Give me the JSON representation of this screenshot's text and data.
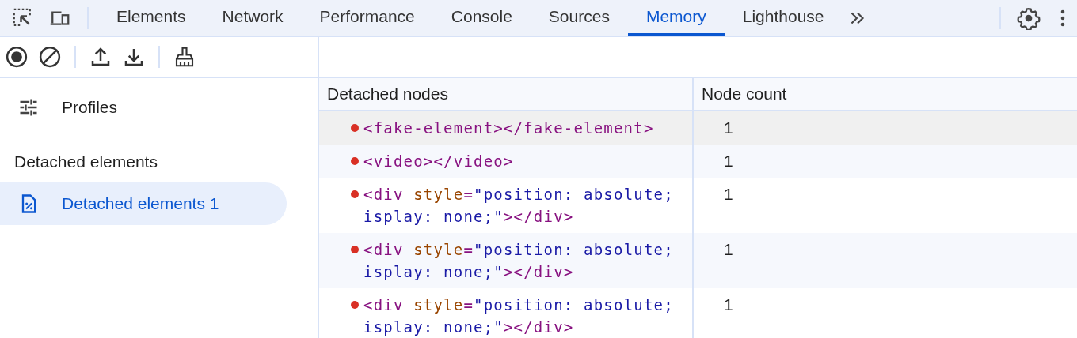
{
  "tabs": [
    {
      "label": "Elements",
      "selected": false
    },
    {
      "label": "Network",
      "selected": false
    },
    {
      "label": "Performance",
      "selected": false
    },
    {
      "label": "Console",
      "selected": false
    },
    {
      "label": "Sources",
      "selected": false
    },
    {
      "label": "Memory",
      "selected": true
    },
    {
      "label": "Lighthouse",
      "selected": false
    }
  ],
  "sidebar": {
    "profiles_label": "Profiles",
    "section_title": "Detached elements",
    "items": [
      {
        "label": "Detached elements 1",
        "selected": true
      }
    ]
  },
  "table": {
    "columns": [
      "Detached nodes",
      "Node count"
    ],
    "rows": [
      {
        "selected": true,
        "count": "1",
        "lines": [
          [
            {
              "kind": "tag",
              "text": "<fake-element></fake-element>"
            }
          ]
        ]
      },
      {
        "selected": false,
        "count": "1",
        "lines": [
          [
            {
              "kind": "tag",
              "text": "<video></video>"
            }
          ]
        ]
      },
      {
        "selected": false,
        "count": "1",
        "lines": [
          [
            {
              "kind": "tag",
              "text": "<div "
            },
            {
              "kind": "attr",
              "text": "style"
            },
            {
              "kind": "tag",
              "text": "="
            },
            {
              "kind": "value",
              "text": "\"position: absolute;"
            }
          ],
          [
            {
              "kind": "value",
              "text": "isplay: none;\""
            },
            {
              "kind": "tag",
              "text": "></div>"
            }
          ]
        ]
      },
      {
        "selected": false,
        "count": "1",
        "lines": [
          [
            {
              "kind": "tag",
              "text": "<div "
            },
            {
              "kind": "attr",
              "text": "style"
            },
            {
              "kind": "tag",
              "text": "="
            },
            {
              "kind": "value",
              "text": "\"position: absolute;"
            }
          ],
          [
            {
              "kind": "value",
              "text": "isplay: none;\""
            },
            {
              "kind": "tag",
              "text": "></div>"
            }
          ]
        ]
      },
      {
        "selected": false,
        "count": "1",
        "lines": [
          [
            {
              "kind": "tag",
              "text": "<div "
            },
            {
              "kind": "attr",
              "text": "style"
            },
            {
              "kind": "tag",
              "text": "="
            },
            {
              "kind": "value",
              "text": "\"position: absolute;"
            }
          ],
          [
            {
              "kind": "value",
              "text": "isplay: none;\""
            },
            {
              "kind": "tag",
              "text": "></div>"
            }
          ]
        ]
      }
    ]
  }
}
